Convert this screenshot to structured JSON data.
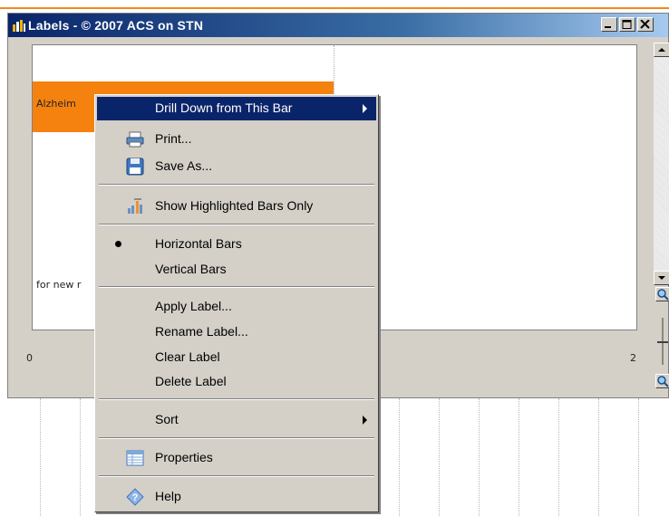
{
  "window": {
    "title": "Labels - © 2007 ACS on STN"
  },
  "chart": {
    "bar_label": "Alzheim",
    "note_label": "for new r",
    "axis_min_label": "0",
    "axis_max_label": "2",
    "bar_color": "#f5820f"
  },
  "context_menu": {
    "drill_down": "Drill Down from This Bar",
    "print": "Print...",
    "save_as": "Save As...",
    "show_highlighted": "Show Highlighted Bars Only",
    "horizontal_bars": "Horizontal Bars",
    "vertical_bars": "Vertical Bars",
    "apply_label": "Apply Label...",
    "rename_label": "Rename Label...",
    "clear_label": "Clear Label",
    "delete_label": "Delete Label",
    "sort": "Sort",
    "properties": "Properties",
    "help": "Help",
    "selected_orientation": "Horizontal Bars"
  },
  "icons": {
    "title": "chart-icon",
    "print": "printer-icon",
    "save": "floppy-disk-icon",
    "highlight": "highlight-bars-icon",
    "properties": "properties-icon",
    "help": "help-icon"
  },
  "colors": {
    "menu_highlight": "#0a246a",
    "titlebar": "#0a246a",
    "accent_orange": "#f08a1c"
  }
}
